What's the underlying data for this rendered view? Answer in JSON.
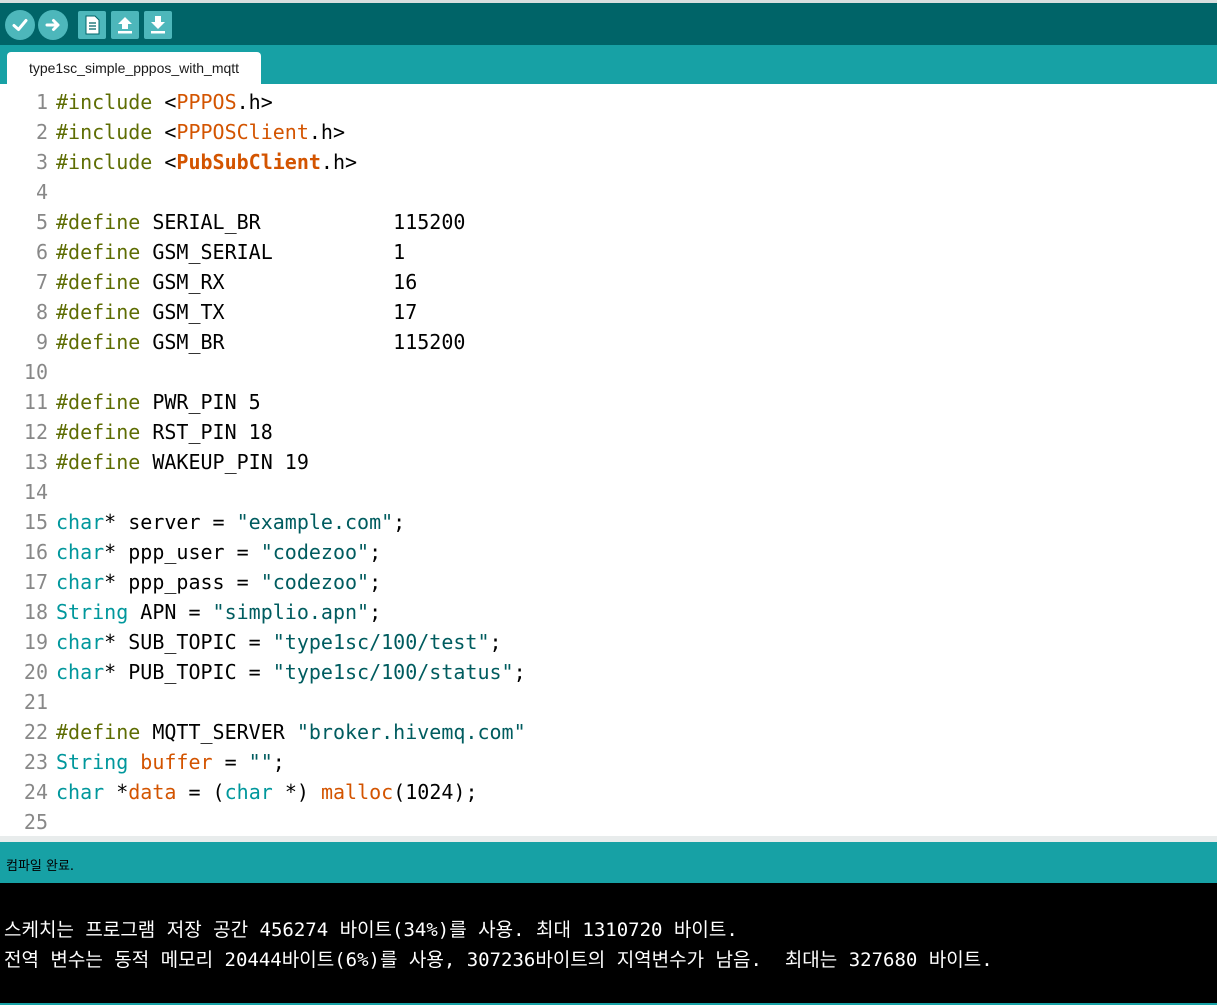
{
  "toolbar": {
    "buttons": [
      {
        "name": "verify",
        "icon": "checkmark-icon"
      },
      {
        "name": "upload",
        "icon": "arrow-right-icon"
      },
      {
        "name": "new",
        "icon": "new-file-icon"
      },
      {
        "name": "open",
        "icon": "open-up-arrow-icon"
      },
      {
        "name": "save",
        "icon": "save-down-arrow-icon"
      }
    ]
  },
  "tab": {
    "label": "type1sc_simple_pppos_with_mqtt"
  },
  "editor": {
    "lines": [
      {
        "n": "1",
        "tokens": [
          [
            "#include",
            "dir"
          ],
          [
            " <",
            ""
          ],
          [
            "PPPOS",
            "lib"
          ],
          [
            ".h>",
            ""
          ]
        ]
      },
      {
        "n": "2",
        "tokens": [
          [
            "#include",
            "dir"
          ],
          [
            " <",
            ""
          ],
          [
            "PPPOSClient",
            "lib"
          ],
          [
            ".h>",
            ""
          ]
        ]
      },
      {
        "n": "3",
        "tokens": [
          [
            "#include",
            "dir"
          ],
          [
            " <",
            ""
          ],
          [
            "PubSubClient",
            "libb"
          ],
          [
            ".h>",
            ""
          ]
        ]
      },
      {
        "n": "4",
        "tokens": []
      },
      {
        "n": "5",
        "tokens": [
          [
            "#define",
            "dir"
          ],
          [
            " SERIAL_BR           115200",
            ""
          ]
        ]
      },
      {
        "n": "6",
        "tokens": [
          [
            "#define",
            "dir"
          ],
          [
            " GSM_SERIAL          1",
            ""
          ]
        ]
      },
      {
        "n": "7",
        "tokens": [
          [
            "#define",
            "dir"
          ],
          [
            " GSM_RX              16",
            ""
          ]
        ]
      },
      {
        "n": "8",
        "tokens": [
          [
            "#define",
            "dir"
          ],
          [
            " GSM_TX              17",
            ""
          ]
        ]
      },
      {
        "n": "9",
        "tokens": [
          [
            "#define",
            "dir"
          ],
          [
            " GSM_BR              115200",
            ""
          ]
        ]
      },
      {
        "n": "10",
        "tokens": []
      },
      {
        "n": "11",
        "tokens": [
          [
            "#define",
            "dir"
          ],
          [
            " PWR_PIN 5",
            ""
          ]
        ]
      },
      {
        "n": "12",
        "tokens": [
          [
            "#define",
            "dir"
          ],
          [
            " RST_PIN 18",
            ""
          ]
        ]
      },
      {
        "n": "13",
        "tokens": [
          [
            "#define",
            "dir"
          ],
          [
            " WAKEUP_PIN 19",
            ""
          ]
        ]
      },
      {
        "n": "14",
        "tokens": []
      },
      {
        "n": "15",
        "tokens": [
          [
            "char",
            "type"
          ],
          [
            "* server = ",
            ""
          ],
          [
            "\"example.com\"",
            "str"
          ],
          [
            ";",
            ""
          ]
        ]
      },
      {
        "n": "16",
        "tokens": [
          [
            "char",
            "type"
          ],
          [
            "* ppp_user = ",
            ""
          ],
          [
            "\"codezoo\"",
            "str"
          ],
          [
            ";",
            ""
          ]
        ]
      },
      {
        "n": "17",
        "tokens": [
          [
            "char",
            "type"
          ],
          [
            "* ppp_pass = ",
            ""
          ],
          [
            "\"codezoo\"",
            "str"
          ],
          [
            ";",
            ""
          ]
        ]
      },
      {
        "n": "18",
        "tokens": [
          [
            "String",
            "type"
          ],
          [
            " APN = ",
            ""
          ],
          [
            "\"simplio.apn\"",
            "str"
          ],
          [
            ";",
            ""
          ]
        ]
      },
      {
        "n": "19",
        "tokens": [
          [
            "char",
            "type"
          ],
          [
            "* SUB_TOPIC = ",
            ""
          ],
          [
            "\"type1sc/100/test\"",
            "str"
          ],
          [
            ";",
            ""
          ]
        ]
      },
      {
        "n": "20",
        "tokens": [
          [
            "char",
            "type"
          ],
          [
            "* PUB_TOPIC = ",
            ""
          ],
          [
            "\"type1sc/100/status\"",
            "str"
          ],
          [
            ";",
            ""
          ]
        ]
      },
      {
        "n": "21",
        "tokens": []
      },
      {
        "n": "22",
        "tokens": [
          [
            "#define",
            "dir"
          ],
          [
            " MQTT_SERVER ",
            ""
          ],
          [
            "\"broker.hivemq.com\"",
            "str"
          ]
        ]
      },
      {
        "n": "23",
        "tokens": [
          [
            "String",
            "type"
          ],
          [
            " ",
            ""
          ],
          [
            "buffer",
            "lib"
          ],
          [
            " = ",
            ""
          ],
          [
            "\"\"",
            "str"
          ],
          [
            ";",
            ""
          ]
        ]
      },
      {
        "n": "24",
        "tokens": [
          [
            "char",
            "type"
          ],
          [
            " *",
            ""
          ],
          [
            "data",
            "lib"
          ],
          [
            " = (",
            ""
          ],
          [
            "char",
            "type"
          ],
          [
            " *) ",
            ""
          ],
          [
            "malloc",
            "lib"
          ],
          [
            "(1024);",
            ""
          ]
        ]
      },
      {
        "n": "25",
        "tokens": []
      }
    ]
  },
  "status": {
    "text": "컴파일 완료."
  },
  "console": {
    "lines": [
      "스케치는 프로그램 저장 공간 456274 바이트(34%)를 사용. 최대 1310720 바이트.",
      "전역 변수는 동적 메모리 20444바이트(6%)를 사용, 307236바이트의 지역변수가 남음.  최대는 327680 바이트."
    ]
  },
  "colors": {
    "toolbar_bg": "#006468",
    "tabbar_bg": "#17a1a5",
    "button_bg": "#4db7bb",
    "directive": "#5e6d03",
    "type": "#00979c",
    "library": "#d35400",
    "string": "#005c5f",
    "console_bg": "#000000"
  }
}
